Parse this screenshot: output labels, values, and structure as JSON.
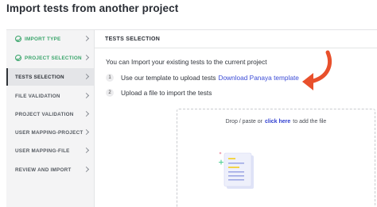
{
  "page": {
    "title": "Import tests from another project"
  },
  "sidebar": {
    "steps": [
      {
        "label": "IMPORT TYPE",
        "state": "done"
      },
      {
        "label": "PROJECT SELECTION",
        "state": "done"
      },
      {
        "label": "TESTS SELECTION",
        "state": "active"
      },
      {
        "label": "FILE VALIDATION",
        "state": "pending"
      },
      {
        "label": "PROJECT VALIDATION",
        "state": "pending"
      },
      {
        "label": "USER MAPPING-PROJECT",
        "state": "pending"
      },
      {
        "label": "USER MAPPING-FILE",
        "state": "pending"
      },
      {
        "label": "REVIEW AND IMPORT",
        "state": "pending"
      }
    ]
  },
  "panel": {
    "header": "TESTS SELECTION",
    "intro": "You can Import your existing tests to the current project",
    "instructions": [
      {
        "number": "1",
        "text": "Use our template to upload tests",
        "link": "Download Panaya template"
      },
      {
        "number": "2",
        "text": "Upload a file to import the tests"
      }
    ],
    "dropzone": {
      "prefix": "Drop / paste or",
      "link": "click here",
      "suffix": "to add the file"
    }
  },
  "colors": {
    "done": "#3aa56b",
    "link": "#3b4bd6",
    "arrow": "#e8502c",
    "sidebar_bg": "#f4f4f5"
  },
  "icons": [
    "check-circle-icon",
    "chevron-right-icon",
    "curved-arrow-icon",
    "file-document-icon"
  ]
}
